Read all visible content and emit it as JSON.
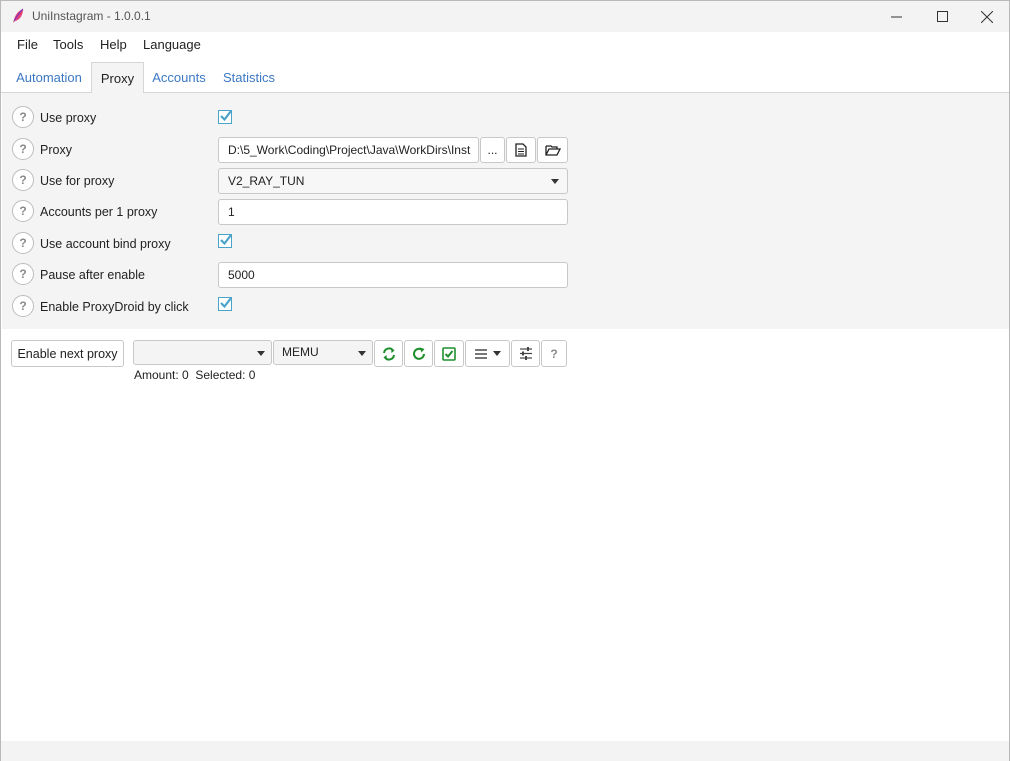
{
  "window": {
    "title": "UniInstagram - 1.0.0.1",
    "controls": {
      "minimize": "minimize-icon",
      "maximize": "maximize-icon",
      "close": "close-icon"
    }
  },
  "menu": [
    "File",
    "Tools",
    "Help",
    "Language"
  ],
  "tabs": [
    {
      "label": "Automation",
      "active": false
    },
    {
      "label": "Proxy",
      "active": true
    },
    {
      "label": "Accounts",
      "active": false
    },
    {
      "label": "Statistics",
      "active": false
    }
  ],
  "settings": {
    "help_glyph": "?",
    "use_proxy": {
      "label": "Use proxy",
      "checked": true
    },
    "proxy": {
      "label": "Proxy",
      "value": "D:\\5_Work\\Coding\\Project\\Java\\WorkDirs\\Inst",
      "browse_label": "..."
    },
    "use_for_proxy": {
      "label": "Use for proxy",
      "value": "V2_RAY_TUN"
    },
    "accounts_per_proxy": {
      "label": "Accounts per 1 proxy",
      "value": "1"
    },
    "use_account_bind_proxy": {
      "label": "Use account bind proxy",
      "checked": true
    },
    "pause_after_enable": {
      "label": "Pause after enable",
      "value": "5000"
    },
    "enable_proxydroid": {
      "label": "Enable ProxyDroid by click",
      "checked": true
    }
  },
  "toolbar": {
    "enable_next_proxy": "Enable next proxy",
    "first_combo_value": "",
    "emulator_combo_value": "MEMU",
    "help_glyph": "?"
  },
  "status": {
    "amount_label": "Amount: 0",
    "selected_label": "Selected: 0"
  },
  "colors": {
    "accent": "#3b78c4",
    "check": "#4aa3c9",
    "green_icon": "#1f8f2e"
  }
}
